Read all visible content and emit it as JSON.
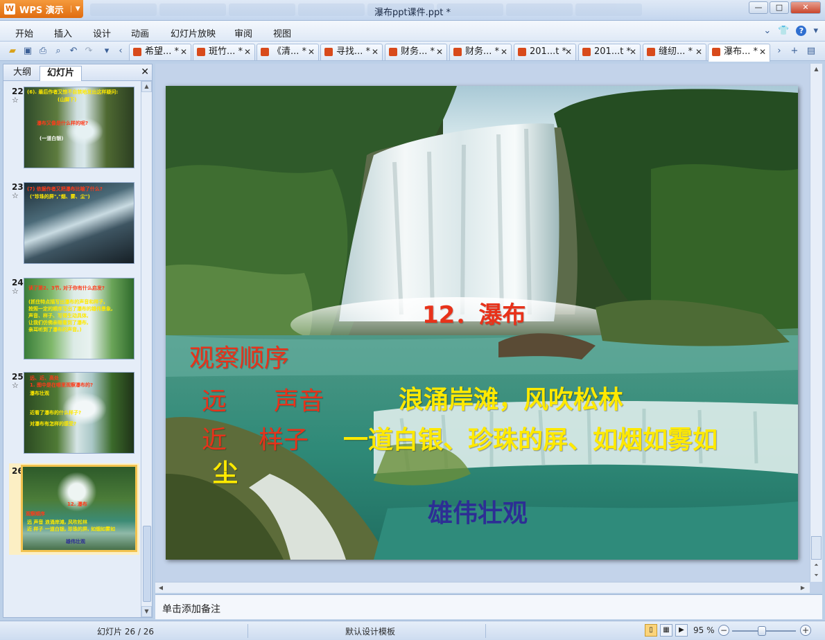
{
  "app": {
    "button_label": "WPS 演示",
    "window_title": "瀑布ppt课件.ppt *"
  },
  "menu": [
    "开始",
    "插入",
    "设计",
    "动画",
    "幻灯片放映",
    "审阅",
    "视图"
  ],
  "doc_tabs": [
    "希望... *",
    "斑竹... *",
    "《清... *",
    "寻找... *",
    "财务... *",
    "财务... *",
    "201...t *",
    "201...t *",
    "缝纫... *",
    "瀑布... *"
  ],
  "left_pane": {
    "tabs": [
      "大纲",
      "幻灯片"
    ],
    "thumbnails": [
      {
        "number": "22",
        "lines": [
          "(6). 最后作者又惊不自禁地发出这样疑问:",
          "(山脚下)",
          "瀑布又像是什么样的呢?",
          "(一道白银)"
        ]
      },
      {
        "number": "23",
        "lines": [
          "(7) 依据作者又把瀑布比喻了什么?",
          "(\"珍珠的屏\",\"烟、雾、尘\")"
        ]
      },
      {
        "number": "24",
        "lines": [
          "读了第2、3节, 对于你有什么启发?",
          "(抓住特点描写出瀑布的声音和样子,",
          "按照一定的顺序写出了瀑布的雄伟景象,",
          "声音、样子、写得生动具体,",
          "让我们仿佛亲眼看到了瀑布,",
          "亲耳听到了瀑布的声音。)"
        ]
      },
      {
        "number": "25",
        "lines": [
          "远、近、高处",
          "1. 图中是在哪里观察瀑布的?",
          "瀑布壮观",
          "近看了瀑布的什么样子?",
          "对瀑布有怎样的感受?"
        ]
      },
      {
        "number": "26",
        "lines": [
          "12. 瀑布",
          "观察顺序",
          "远  声音   浪涌岸滩, 风吹松林",
          "近  样子   一道白银, 珍珠的屏, 如烟如雾如",
          "雄伟壮观"
        ]
      }
    ]
  },
  "slide": {
    "title": "12．瀑布",
    "order_heading": "观察顺序",
    "far_label": "远",
    "sound_label": "声音",
    "sound_desc": "浪涌岸滩，风吹松林",
    "near_label": "近",
    "look_label": "样子",
    "look_desc": "一道白银、珍珠的屏、如烟如雾如",
    "look_desc_cont": "尘",
    "conclusion": "雄伟壮观"
  },
  "notes_placeholder": "单击添加备注",
  "status": {
    "slide_counter": "幻灯片 26 / 26",
    "template": "默认设计模板",
    "zoom": "95 %"
  },
  "colors": {
    "title_red": "#e8321a",
    "highlight_yellow": "#ffe900",
    "conclusion_navy": "#2d2e94",
    "wps_orange": "#e06c10"
  }
}
